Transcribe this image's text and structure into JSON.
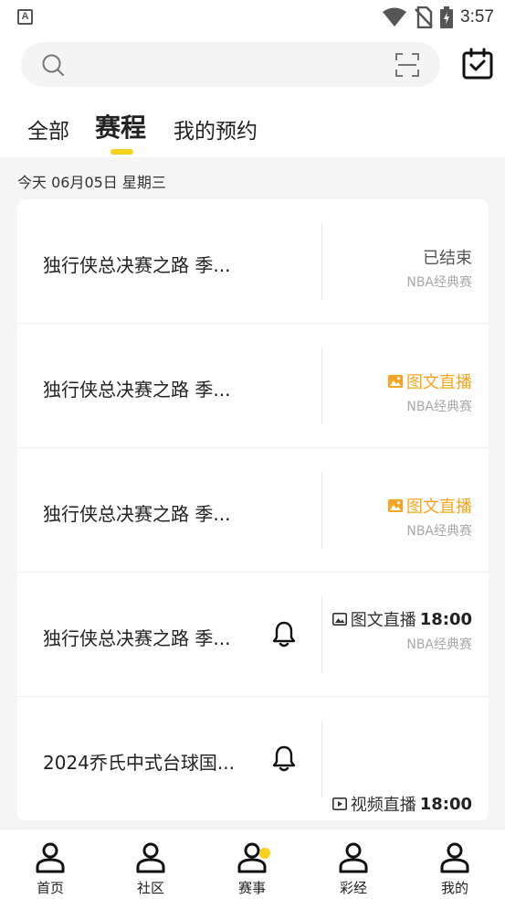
{
  "status_bar": {
    "app_icon_letter": "A",
    "time": "3:57",
    "icons": [
      "wifi-icon",
      "no-sim-icon",
      "battery-charging-icon"
    ]
  },
  "search": {
    "placeholder": "",
    "icons": [
      "search-icon",
      "scan-icon",
      "calendar-check-icon"
    ]
  },
  "tabs": [
    {
      "label": "全部",
      "active": false
    },
    {
      "label": "赛程",
      "active": true
    },
    {
      "label": "我的预约",
      "active": false
    }
  ],
  "accent_color": "#f7d21c",
  "live_color": "#f5a623",
  "date_header": "今天 06月05日 星期三",
  "matches": [
    {
      "title": "独行侠总决赛之路 季...",
      "status": "已结束",
      "status_type": "ended",
      "league": "NBA经典赛",
      "bell": false
    },
    {
      "title": "独行侠总决赛之路 季...",
      "status": "图文直播",
      "status_type": "live",
      "league": "NBA经典赛",
      "bell": false
    },
    {
      "title": "独行侠总决赛之路 季...",
      "status": "图文直播",
      "status_type": "live",
      "league": "NBA经典赛",
      "bell": false
    },
    {
      "title": "独行侠总决赛之路 季...",
      "status": "图文直播",
      "time": "18:00",
      "status_type": "scheduled",
      "league": "NBA经典赛",
      "bell": true
    },
    {
      "title": "2024乔氏中式台球国...",
      "status": "视频直播",
      "time": "18:00",
      "status_type": "scheduled-video",
      "league": "",
      "bell": true
    }
  ],
  "refresh_icon": "refresh-icon",
  "bottom_nav": [
    {
      "label": "首页",
      "icon": "person-icon"
    },
    {
      "label": "社区",
      "icon": "person-icon"
    },
    {
      "label": "赛事",
      "icon": "person-icon",
      "active": true
    },
    {
      "label": "彩经",
      "icon": "person-icon"
    },
    {
      "label": "我的",
      "icon": "person-icon"
    }
  ]
}
